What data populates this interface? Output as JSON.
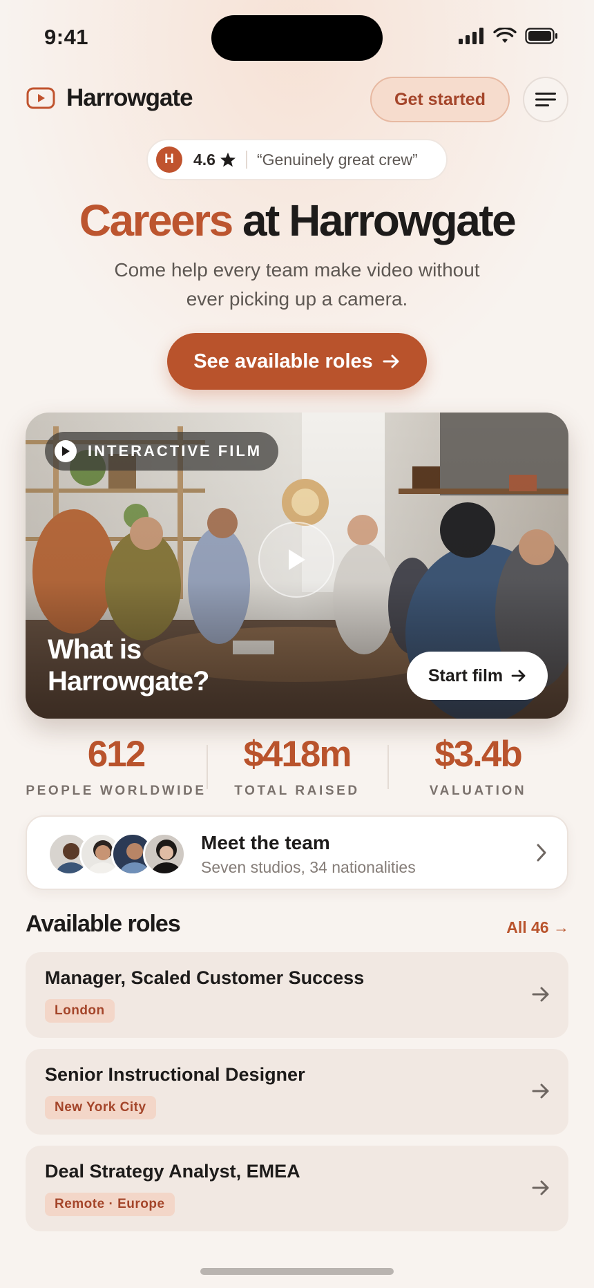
{
  "status_bar": {
    "time": "9:41"
  },
  "header": {
    "app_name": "Harrowgate",
    "get_started_label": "Get started"
  },
  "rating": {
    "avatar_initial": "H",
    "score": "4.6",
    "quote": "“Genuinely great crew”"
  },
  "hero": {
    "title_accent": "Careers",
    "title_rest": "at Harrowgate",
    "subtitle": "Come help every team make video without ever picking up a camera.",
    "cta_label": "See available roles"
  },
  "film": {
    "badge": "INTERACTIVE FILM",
    "title": "What is Harrowgate?",
    "start_label": "Start film"
  },
  "stats": [
    {
      "value": "612",
      "label": "PEOPLE WORLDWIDE"
    },
    {
      "value": "$418m",
      "label": "TOTAL RAISED"
    },
    {
      "value": "$3.4b",
      "label": "VALUATION"
    }
  ],
  "team": {
    "title": "Meet the team",
    "subtitle": "Seven studios, 34 nationalities"
  },
  "roles": {
    "heading": "Available roles",
    "all_label": "All 46 →",
    "items": [
      {
        "title": "Manager, Scaled Customer Success",
        "location": "London"
      },
      {
        "title": "Senior Instructional Designer",
        "location": "New York City"
      },
      {
        "title": "Deal Strategy Analyst, EMEA",
        "location": "Remote · Europe"
      }
    ]
  },
  "colors": {
    "accent": "#b9532c",
    "accent_soft": "#f6dccd",
    "background": "#f8f3ef",
    "card": "#f1e8e2"
  },
  "icons": [
    "play-icon",
    "menu-icon",
    "star-icon",
    "arrow-right-icon",
    "chevron-right-icon",
    "signal-icon",
    "wifi-icon",
    "battery-icon"
  ]
}
